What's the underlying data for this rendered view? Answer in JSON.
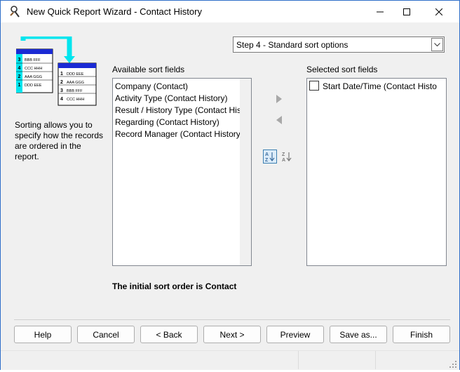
{
  "window": {
    "title": "New Quick Report Wizard - Contact History"
  },
  "step_select": {
    "value": "Step 4 - Standard sort options"
  },
  "illustration": {
    "back_rows": [
      [
        "3",
        "BBB FFF"
      ],
      [
        "4",
        "CCC HHH"
      ],
      [
        "2",
        "AAA GGG"
      ],
      [
        "1",
        "DDD EEE"
      ]
    ],
    "front_rows": [
      [
        "1",
        "DDD EEE"
      ],
      [
        "2",
        "AAA GGG"
      ],
      [
        "3",
        "BBB FFF"
      ],
      [
        "4",
        "CCC HHH"
      ]
    ]
  },
  "description": "Sorting allows you to specify how the records are ordered in the report.",
  "available": {
    "label": "Available sort fields",
    "items": [
      "Company (Contact)",
      "Activity Type (Contact History)",
      "Result / History Type (Contact His",
      "Regarding (Contact History)",
      "Record Manager (Contact History"
    ]
  },
  "selected": {
    "label": "Selected sort fields",
    "items": [
      "Start Date/Time (Contact Histo"
    ]
  },
  "hint": "The initial sort order is Contact",
  "buttons": {
    "help": "Help",
    "cancel": "Cancel",
    "back": "< Back",
    "next": "Next >",
    "preview": "Preview",
    "save_as": "Save as...",
    "finish": "Finish"
  },
  "colors": {
    "accent": "#0078d7",
    "illustration_cyan": "#00e5ee",
    "illustration_blue": "#1a2ad4"
  },
  "icons": {
    "app": "magnifier-wand-icon",
    "move_right": "triangle-right-icon",
    "move_left": "triangle-left-icon",
    "sort_asc": "sort-a-z-icon",
    "sort_desc": "sort-z-a-icon"
  }
}
